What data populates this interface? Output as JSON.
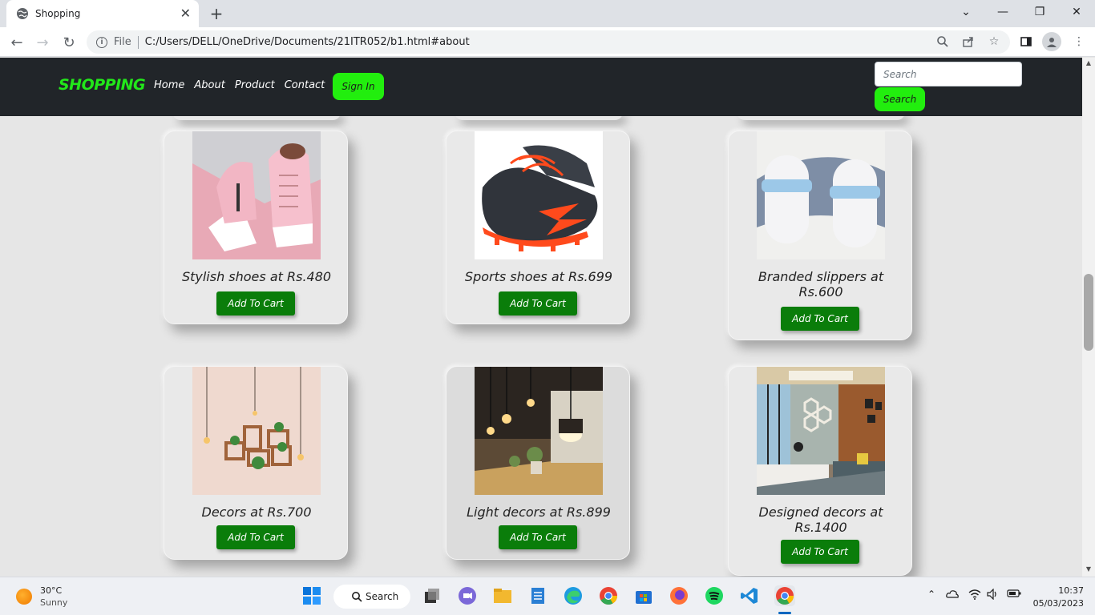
{
  "browser": {
    "tab_title": "Shopping",
    "tab_close": "✕",
    "new_tab": "+",
    "omnibox_file_label": "File",
    "url": "C:/Users/DELL/OneDrive/Documents/21ITR052/b1.html#about"
  },
  "site": {
    "brand": "SHOPPING",
    "nav_links": [
      "Home",
      "About",
      "Product",
      "Contact"
    ],
    "signin_label": "Sign In",
    "search_placeholder": "Search",
    "search_button": "Search"
  },
  "products": [
    {
      "caption": "Stylish shoes at Rs.480",
      "button": "Add To Cart",
      "icon": "pink-boots-image"
    },
    {
      "caption": "Sports shoes at Rs.699",
      "button": "Add To Cart",
      "icon": "football-boots-image"
    },
    {
      "caption": "Branded slippers at Rs.600",
      "button": "Add To Cart",
      "icon": "slippers-image"
    },
    {
      "caption": "Decors at Rs.700",
      "button": "Add To Cart",
      "icon": "wall-shelves-image"
    },
    {
      "caption": "Light decors at Rs.899",
      "button": "Add To Cart",
      "icon": "pendant-lights-image"
    },
    {
      "caption": "Designed decors at Rs.1400",
      "button": "Add To Cart",
      "icon": "office-room-image"
    }
  ],
  "taskbar": {
    "temperature": "30°C",
    "condition": "Sunny",
    "search_label": "Search",
    "time": "10:37",
    "date": "05/03/2023"
  },
  "colors": {
    "accent_green": "#22ee0e",
    "cart_green": "#0a7d0a",
    "nav_dark": "#212529"
  }
}
